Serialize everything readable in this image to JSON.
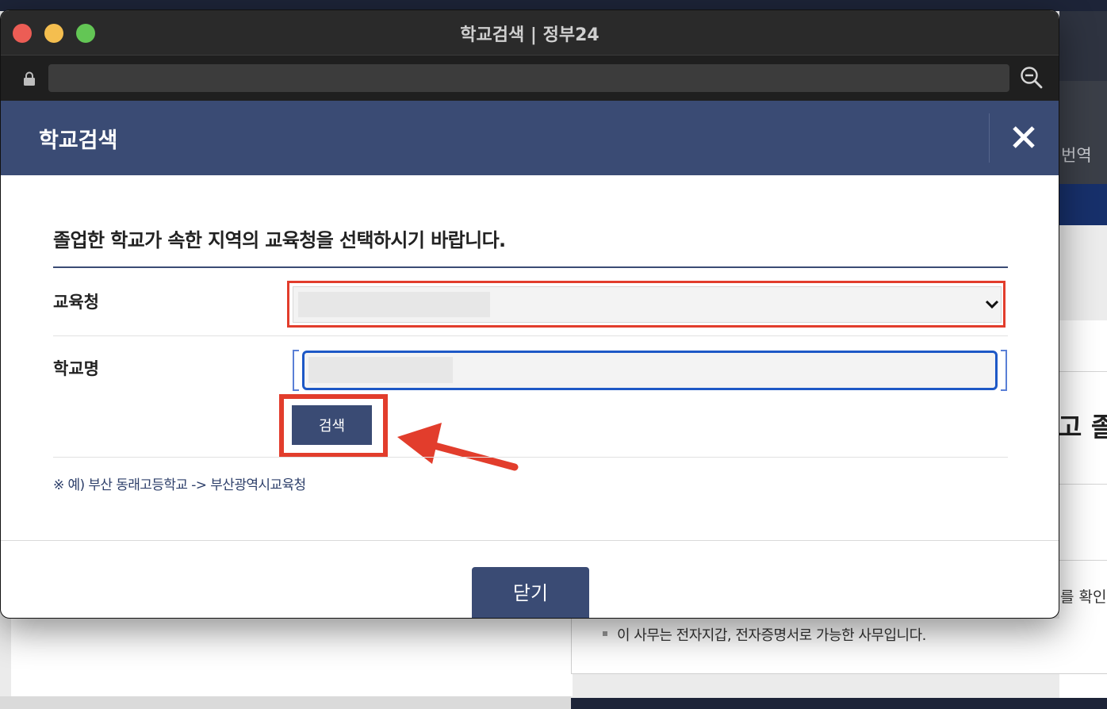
{
  "background": {
    "translate_label": "번역",
    "heading_fragment": "고 졸",
    "confirm_fragment": "를 확인",
    "notice": "이 사무는 전자지갑, 전자증명서로 가능한 사무입니다."
  },
  "window": {
    "title": "학교검색 | 정부24",
    "url": ""
  },
  "dialog": {
    "title": "학교검색",
    "instruction": "졸업한 학교가 속한 지역의 교육청을 선택하시기 바랍니다.",
    "fields": {
      "office_label": "교육청",
      "office_value": "",
      "school_label": "학교명",
      "school_value": ""
    },
    "search_button": "검색",
    "example": "※ 예) 부산 동래고등학교 -> 부산광역시교육청",
    "close_button": "닫기"
  },
  "colors": {
    "header_navy": "#3a4b74",
    "highlight_red": "#e23d2c",
    "focus_blue": "#1d58c6"
  }
}
